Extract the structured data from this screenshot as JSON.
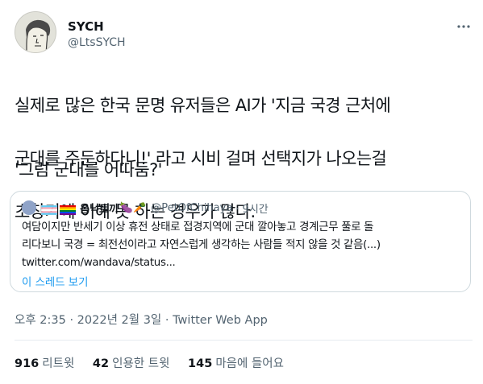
{
  "author": {
    "name": "SYCH",
    "handle": "@LtsSYCH"
  },
  "tweet": {
    "lines": [
      "실제로 많은 한국 문명 유저들은 AI가 '지금 국경 근처에",
      "군대를 주둔하다니!' 라고 시비 걸며 선택지가 나오는걸",
      "초창기에 이해 못 하는 경우가 많다."
    ],
    "line2": "'그럼 군대를 어따둠?'"
  },
  "quote": {
    "name": "옴닉토끼",
    "emoji": "🍆🥕",
    "handle": "@PetOfChihaya",
    "time": "· 9시간",
    "body_lines": [
      "여담이지만 반세기 이상 휴전 상태로 접경지역에 군대 깔아놓고 경계근무 풀로 돌",
      "리다보니 국경 = 최전선이라고 자연스럽게 생각하는 사람들 적지 않을 것 같음(...)"
    ],
    "link": "twitter.com/wandava/status...",
    "thread_label": "이 스레드 보기"
  },
  "meta": {
    "time": "오후 2:35 · 2022년 2월 3일 · Twitter Web App"
  },
  "stats": {
    "retweets": "916",
    "retweets_label": "리트윗",
    "quotes": "42",
    "quotes_label": "인용한 트윗",
    "likes": "145",
    "likes_label": "마음에 들어요"
  },
  "icons": {
    "more": "more-horizontal-icon",
    "avatar": "avatar"
  },
  "colors": {
    "link": "#1d9bf0",
    "secondary": "#536471",
    "border": "#cfd9de"
  }
}
